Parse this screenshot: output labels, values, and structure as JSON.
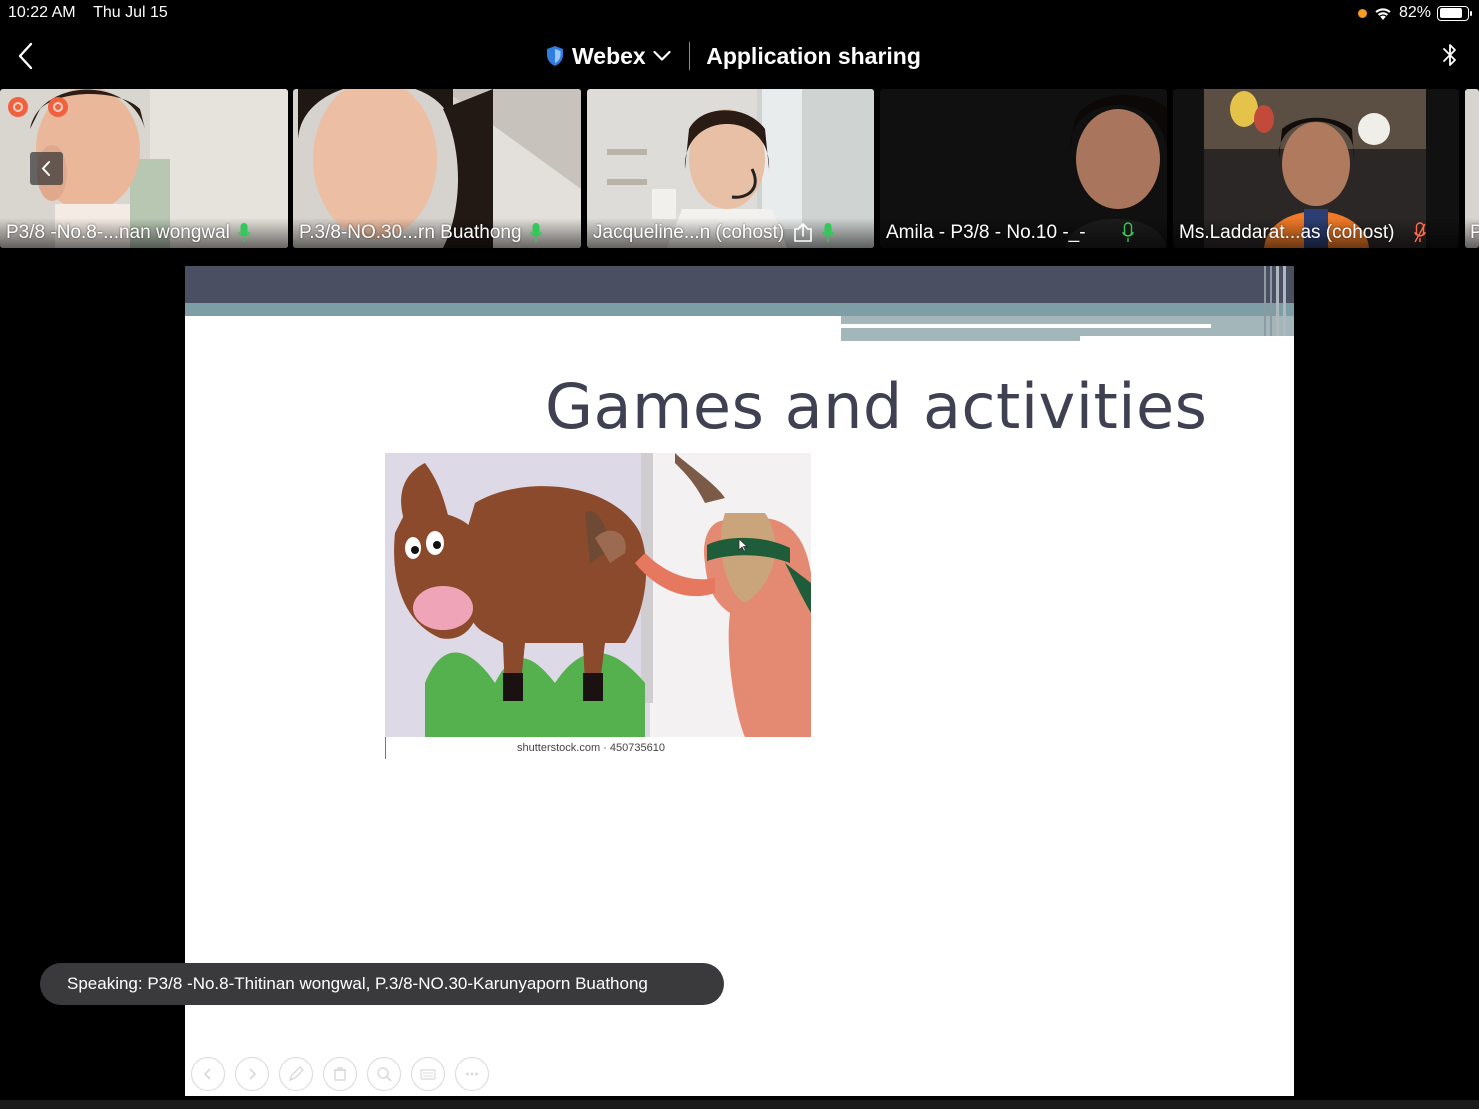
{
  "status_bar": {
    "time": "10:22 AM",
    "date": "Thu Jul 15",
    "battery": "82%",
    "battery_level": 0.82
  },
  "nav": {
    "app_name": "Webex",
    "title": "Application sharing"
  },
  "participants": [
    {
      "name": "P3/8 -No.8-...nan wongwal",
      "mic": "on"
    },
    {
      "name": "P.3/8-NO.30...rn Buathong",
      "mic": "on"
    },
    {
      "name": "Jacqueline...n (cohost)",
      "mic": "on",
      "sharing": true
    },
    {
      "name": "Amila - P3/8 - No.10 -_-",
      "mic": "on"
    },
    {
      "name": "Ms.Laddarat...as (cohost)",
      "mic": "muted"
    },
    {
      "name": "P"
    }
  ],
  "slide": {
    "title": "Games and activities",
    "image_caption": "shutterstock.com · 450735610"
  },
  "speaking_banner": "Speaking: P3/8 -No.8-Thitinan wongwal, P.3/8-NO.30-Karunyaporn Buathong",
  "slide_toolbar": [
    "previous-slide-icon",
    "next-slide-icon",
    "pen-icon",
    "eraser-icon",
    "zoom-icon",
    "keyboard-icon",
    "more-icon"
  ],
  "colors": {
    "accent_green": "#34c759",
    "muted_red": "#ff6b4a",
    "slide_title": "#3f4152",
    "slide_band_dark": "#4a5061",
    "slide_band_teal": "#7d9ea5"
  }
}
